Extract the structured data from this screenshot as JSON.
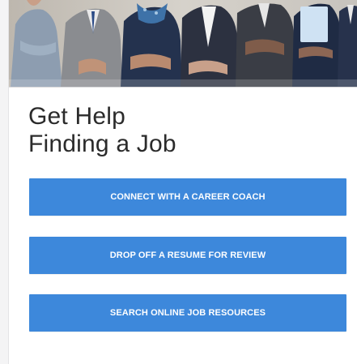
{
  "hero": {
    "description_icon": "people-in-business-attire-photo"
  },
  "heading": {
    "line1": "Get Help",
    "line2": "Finding a Job"
  },
  "actions": [
    {
      "label": "CONNECT WITH A CAREER COACH"
    },
    {
      "label": "DROP OFF A RESUME FOR REVIEW"
    },
    {
      "label": "SEARCH ONLINE JOB RESOURCES"
    }
  ],
  "colors": {
    "button": "#3d88db",
    "button_text": "#ffffff",
    "heading_text": "#2b2b2b",
    "card_bg": "#ffffff"
  }
}
